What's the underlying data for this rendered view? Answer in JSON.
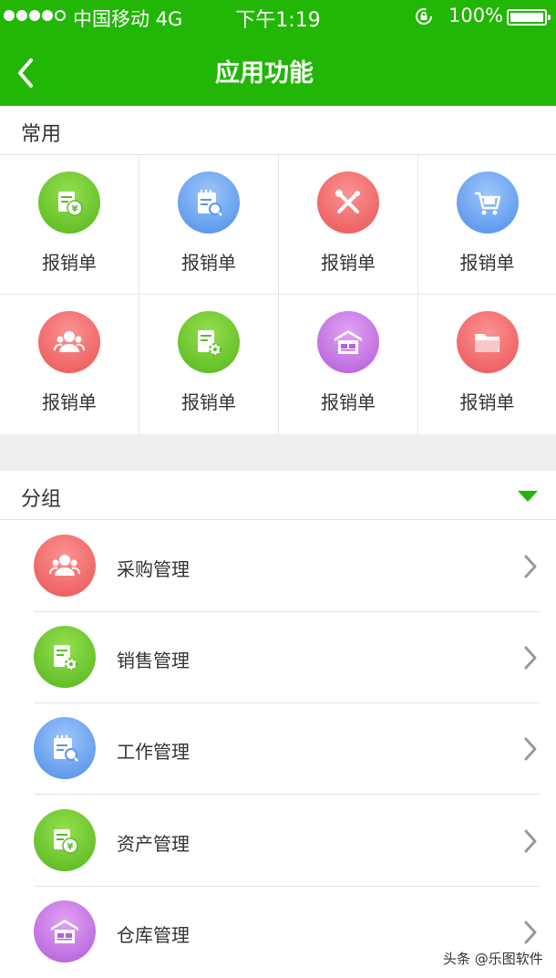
{
  "status_bar": {
    "carrier": "中国移动",
    "network": "4G",
    "time": "下午1:19",
    "battery": "100%"
  },
  "nav": {
    "title": "应用功能"
  },
  "common": {
    "title": "常用",
    "items": [
      {
        "label": "报销单",
        "icon": "invoice-yen-icon",
        "color": "#5cbd24"
      },
      {
        "label": "报销单",
        "icon": "notepad-search-icon",
        "color": "#5b96ec"
      },
      {
        "label": "报销单",
        "icon": "tools-icon",
        "color": "#ee5f5f"
      },
      {
        "label": "报销单",
        "icon": "shopping-cart-icon",
        "color": "#5b96ec"
      },
      {
        "label": "报销单",
        "icon": "users-icon",
        "color": "#ee5f5f"
      },
      {
        "label": "报销单",
        "icon": "document-gear-icon",
        "color": "#5cbd24"
      },
      {
        "label": "报销单",
        "icon": "warehouse-icon",
        "color": "#b860dc"
      },
      {
        "label": "报销单",
        "icon": "folder-icon",
        "color": "#ee5f5f"
      }
    ]
  },
  "group": {
    "title": "分组",
    "items": [
      {
        "label": "采购管理",
        "icon": "users-icon",
        "color": "#ee5f5f"
      },
      {
        "label": "销售管理",
        "icon": "document-gear-icon",
        "color": "#5cbd24"
      },
      {
        "label": "工作管理",
        "icon": "notepad-search-icon",
        "color": "#5b96ec"
      },
      {
        "label": "资产管理",
        "icon": "invoice-yen-icon",
        "color": "#5cbd24"
      },
      {
        "label": "仓库管理",
        "icon": "warehouse-icon",
        "color": "#b860dc"
      }
    ]
  },
  "watermark": "头条 @乐图软件",
  "theme": {
    "primary": "#22b607"
  }
}
